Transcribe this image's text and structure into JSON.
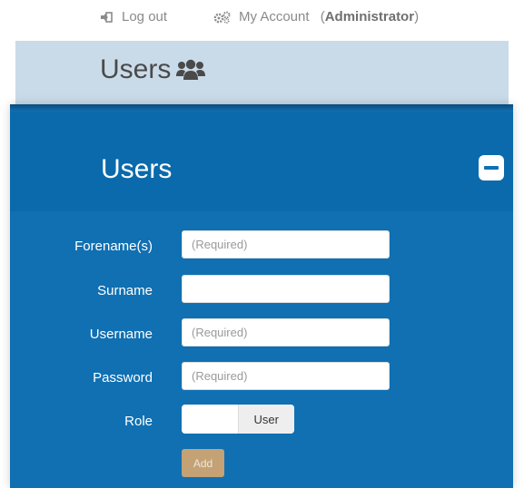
{
  "topnav": {
    "logout_label": "Log out",
    "account_label": "My Account",
    "account_role_open": "(",
    "account_role": "Administrator",
    "account_role_close": ")"
  },
  "page": {
    "title": "Users"
  },
  "panel": {
    "title": "Users",
    "form": {
      "forename_label": "Forename(s)",
      "forename_placeholder": "(Required)",
      "surname_label": "Surname",
      "surname_placeholder": "",
      "username_label": "Username",
      "username_placeholder": "(Required)",
      "password_label": "Password",
      "password_placeholder": "(Required)",
      "role_label": "Role",
      "role_value": "User",
      "add_label": "Add"
    }
  },
  "colors": {
    "panel_blue": "#1070b2",
    "header_band": "#c9dbe9",
    "add_button": "#c4a276"
  }
}
